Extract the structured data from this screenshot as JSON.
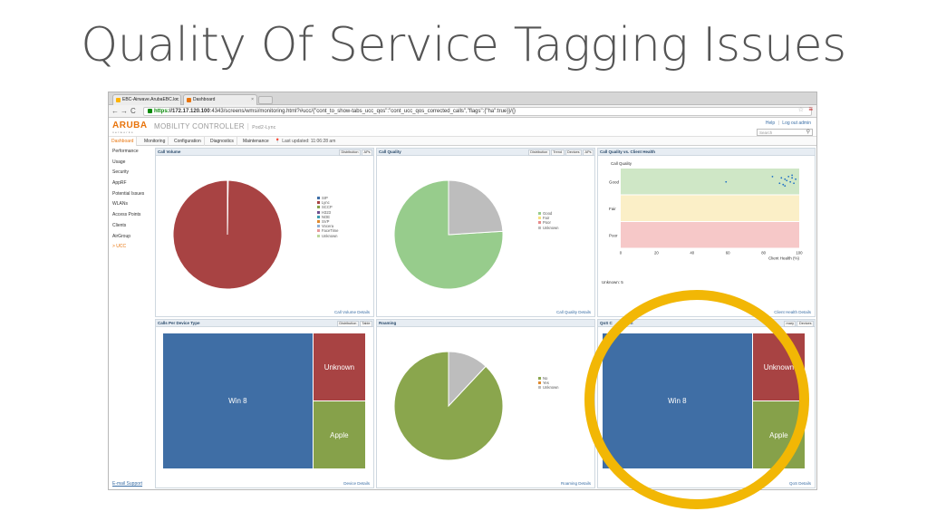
{
  "slide": {
    "title": "Quality Of Service Tagging Issues"
  },
  "browser": {
    "tabs": [
      {
        "label": "EBC-Airwave.ArubaEBC.loc",
        "favicon_color": "#ffb300"
      },
      {
        "label": "Dashboard",
        "favicon_color": "#e8740c"
      }
    ],
    "url_scheme": "https:",
    "url_host": "//172.17.120.100",
    "url_rest": ":4343/screens/wmsi/monitoring.html?#ucc/{\"cont_to_show-tabs_ucc_qos\":\"cont_ucc_qos_corrected_calls\",\"flags\":{\"ha\":true}}/{}"
  },
  "app": {
    "logo": "ARUBA",
    "logo_sub": "networks",
    "product": "MOBILITY CONTROLLER",
    "host": "Pod2-Lync",
    "help": "Help",
    "logout": "Log out admin",
    "search_placeholder": "Search",
    "nav_tabs": [
      "Dashboard",
      "Monitoring",
      "Configuration",
      "Diagnostics",
      "Maintenance"
    ],
    "last_updated": "Last updated: 11:06:28 am",
    "sidebar": [
      "Performance",
      "Usage",
      "Security",
      "AppRF",
      "Potential Issues",
      "WLANs",
      "Access Points",
      "Clients",
      "AirGroup",
      "> UCC"
    ],
    "email_support": "E-mail Support"
  },
  "panels": {
    "call_volume": {
      "title": "Call Volume",
      "tabs": [
        "Distribution",
        "APs"
      ],
      "legend": [
        {
          "label": "SIP",
          "color": "#3e6ea6"
        },
        {
          "label": "Lync",
          "color": "#a84343"
        },
        {
          "label": "SCCP",
          "color": "#86a14a"
        },
        {
          "label": "H323",
          "color": "#6f4f8f"
        },
        {
          "label": "NOE",
          "color": "#3a9db0"
        },
        {
          "label": "SVP",
          "color": "#e08a2e"
        },
        {
          "label": "Vocera",
          "color": "#8fb0d6"
        },
        {
          "label": "FaceTime",
          "color": "#e79a9a"
        },
        {
          "label": "Unknown",
          "color": "#bcd79c"
        }
      ],
      "footer": "Call Volume Details"
    },
    "call_quality": {
      "title": "Call Quality",
      "tabs": [
        "Distribution",
        "Trend",
        "Devices",
        "APs"
      ],
      "legend": [
        {
          "label": "Good",
          "color": "#97cc8c"
        },
        {
          "label": "Fair",
          "color": "#f7e07a"
        },
        {
          "label": "Poor",
          "color": "#e88a8a"
        },
        {
          "label": "Unknown",
          "color": "#bdbdbd"
        }
      ],
      "footer": "Call Quality Details"
    },
    "quality_vs_health": {
      "title": "Call Quality vs. Client Health",
      "ylabel": "Call Quality",
      "bands": [
        "Good",
        "Fair",
        "Poor"
      ],
      "xticks": [
        "0",
        "20",
        "40",
        "60",
        "80",
        "100"
      ],
      "xlabel": "Client Health (%)",
      "unknown_note": "Unknown:  5",
      "footer": "Client Health Details"
    },
    "calls_per_device": {
      "title": "Calls Per Device Type",
      "tabs": [
        "Distribution",
        "Table"
      ],
      "footer": "Device Details"
    },
    "roaming": {
      "title": "Roaming",
      "legend": [
        {
          "label": "No",
          "color": "#8aa64d"
        },
        {
          "label": "Yes",
          "color": "#e08a2e"
        },
        {
          "label": "Unknown",
          "color": "#bdbdbd"
        }
      ],
      "footer": "Roaming Details"
    },
    "qos": {
      "title_visible": "QoS C",
      "title_tail": "ction",
      "tabs": [
        "mary",
        "Devices"
      ],
      "footer": "QoS Details"
    }
  },
  "chart_data": [
    {
      "type": "pie",
      "title": "Call Volume",
      "categories": [
        "Lync",
        "SIP"
      ],
      "values": [
        99.8,
        0.2
      ],
      "colors": [
        "#a84343",
        "#3e6ea6"
      ]
    },
    {
      "type": "pie",
      "title": "Call Quality",
      "categories": [
        "Good",
        "Unknown"
      ],
      "values": [
        76,
        24
      ],
      "colors": [
        "#97cc8c",
        "#bdbdbd"
      ]
    },
    {
      "type": "scatter",
      "title": "Call Quality vs. Client Health",
      "xlabel": "Client Health (%)",
      "ylabel": "Call Quality",
      "xlim": [
        0,
        100
      ],
      "x": [
        59,
        85,
        89,
        90,
        91,
        92,
        93,
        94,
        95,
        96,
        97,
        98,
        92,
        96
      ],
      "y": [
        "Good",
        "Good",
        "Good",
        "Good",
        "Good",
        "Good",
        "Good",
        "Good",
        "Good",
        "Good",
        "Good",
        "Good",
        "Good",
        "Good"
      ],
      "y_offsets": [
        0.5,
        0.3,
        0.55,
        0.35,
        0.6,
        0.4,
        0.45,
        0.3,
        0.5,
        0.35,
        0.55,
        0.4,
        0.65,
        0.25
      ]
    },
    {
      "type": "treemap",
      "title": "Calls Per Device Type",
      "categories": [
        "Win 8",
        "Unknown",
        "Apple"
      ],
      "values": [
        74,
        13,
        13
      ],
      "colors": [
        "#3f6ea5",
        "#a84343",
        "#86a14a"
      ]
    },
    {
      "type": "pie",
      "title": "Roaming",
      "categories": [
        "No",
        "Unknown"
      ],
      "values": [
        88,
        12
      ],
      "colors": [
        "#8aa64d",
        "#bdbdbd"
      ]
    },
    {
      "type": "treemap",
      "title": "QoS Correction",
      "categories": [
        "Win 8",
        "Unknown",
        "Apple"
      ],
      "values": [
        74,
        13,
        13
      ],
      "colors": [
        "#3f6ea5",
        "#a84343",
        "#86a14a"
      ]
    }
  ]
}
